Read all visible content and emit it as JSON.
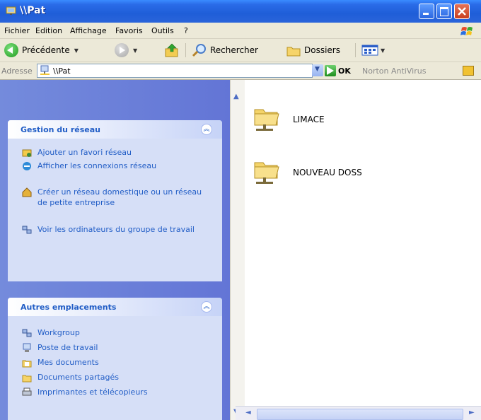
{
  "window": {
    "title": "\\\\Pat",
    "colors": {
      "titlebar": "#1F5ED8",
      "panel": "#6375D6",
      "task_text": "#215DC6",
      "close": "#C8401F"
    }
  },
  "menu": [
    {
      "label": "Fichier"
    },
    {
      "label": "Edition"
    },
    {
      "label": "Affichage"
    },
    {
      "label": "Favoris"
    },
    {
      "label": "Outils"
    },
    {
      "label": "?"
    }
  ],
  "toolbar": {
    "back_label": "Précédente",
    "search_label": "Rechercher",
    "folders_label": "Dossiers"
  },
  "address": {
    "label": "Adresse",
    "value": "\\\\Pat",
    "go_label": "OK",
    "norton_label": "Norton AntiVirus"
  },
  "groups": [
    {
      "title": "Gestion du réseau",
      "tasks": [
        {
          "label": "Ajouter un favori réseau",
          "icon": "add-network-place-icon"
        },
        {
          "label": "Afficher les connexions réseau",
          "icon": "network-connections-icon"
        },
        {
          "label": "Créer un réseau domestique ou un réseau de petite entreprise",
          "icon": "home-network-icon"
        },
        {
          "label": "Voir les ordinateurs du groupe de travail",
          "icon": "workgroup-computers-icon"
        }
      ]
    },
    {
      "title": "Autres emplacements",
      "tasks": [
        {
          "label": "Workgroup",
          "icon": "workgroup-icon"
        },
        {
          "label": "Poste de travail",
          "icon": "my-computer-icon"
        },
        {
          "label": "Mes documents",
          "icon": "my-documents-icon"
        },
        {
          "label": "Documents partagés",
          "icon": "shared-documents-icon"
        },
        {
          "label": "Imprimantes et télécopieurs",
          "icon": "printers-icon"
        }
      ]
    }
  ],
  "items": [
    {
      "label": "LIMACE",
      "icon": "shared-folder-icon"
    },
    {
      "label": "NOUVEAU DOSS",
      "icon": "shared-folder-icon"
    }
  ]
}
